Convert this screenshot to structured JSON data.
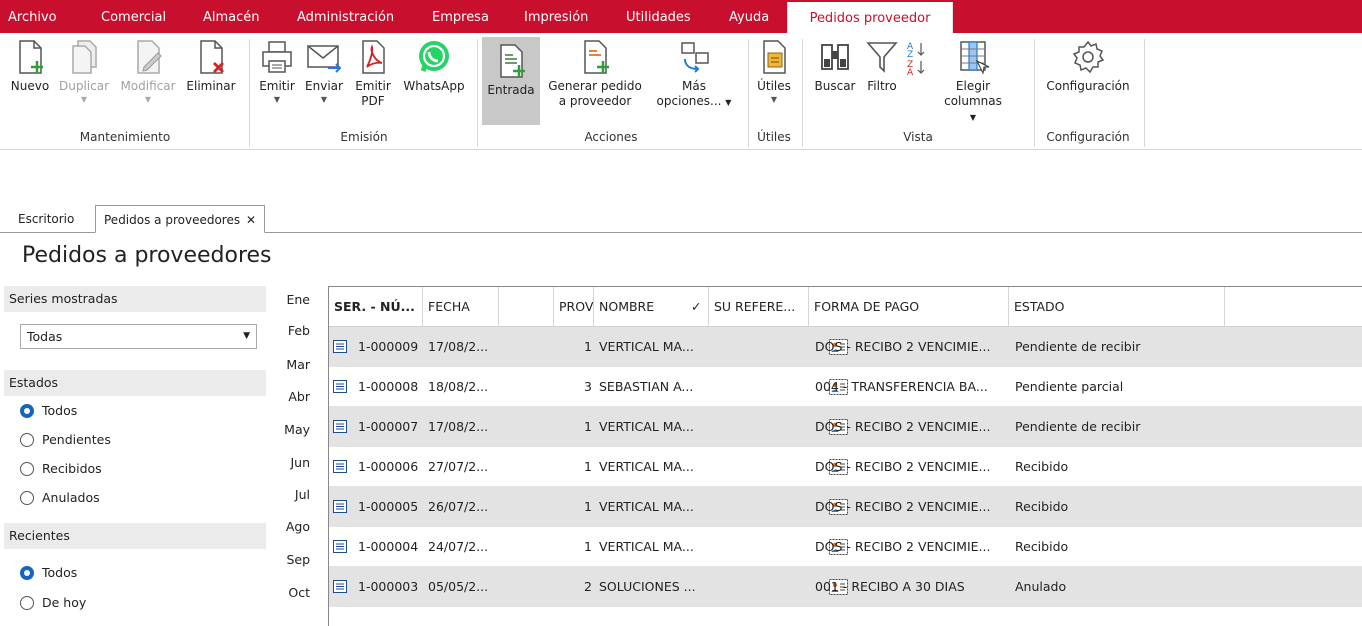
{
  "menu": {
    "items": [
      "Archivo",
      "Comercial",
      "Almacén",
      "Administración",
      "Empresa",
      "Impresión",
      "Utilidades",
      "Ayuda"
    ],
    "active": "Pedidos proveedor"
  },
  "ribbon": {
    "mantenimiento": {
      "label": "Mantenimiento",
      "nuevo": "Nuevo",
      "duplicar": "Duplicar",
      "modificar": "Modificar",
      "eliminar": "Eliminar"
    },
    "emision": {
      "label": "Emisión",
      "emitir": "Emitir",
      "enviar": "Enviar",
      "emitir_pdf_1": "Emitir",
      "emitir_pdf_2": "PDF",
      "whatsapp": "WhatsApp"
    },
    "acciones": {
      "label": "Acciones",
      "entrada": "Entrada",
      "generar_1": "Generar pedido",
      "generar_2": "a proveedor",
      "mas_1": "Más",
      "mas_2": "opciones..."
    },
    "utiles": {
      "label": "Útiles",
      "utiles": "Útiles"
    },
    "vista": {
      "label": "Vista",
      "buscar": "Buscar",
      "filtro": "Filtro",
      "elegir_1": "Elegir",
      "elegir_2": "columnas"
    },
    "configuracion": {
      "label": "Configuración",
      "configuracion": "Configuración"
    }
  },
  "tabs": [
    "Escritorio",
    "Pedidos a proveedores"
  ],
  "page_title": "Pedidos a proveedores",
  "filters": {
    "series": {
      "label": "Series mostradas",
      "value": "Todas"
    },
    "estados": {
      "label": "Estados",
      "options": [
        "Todos",
        "Pendientes",
        "Recibidos",
        "Anulados"
      ],
      "selected": "Todos"
    },
    "recientes": {
      "label": "Recientes",
      "options": [
        "Todos",
        "De hoy"
      ],
      "selected": "Todos"
    }
  },
  "months": [
    "Ene",
    "Feb",
    "Mar",
    "Abr",
    "May",
    "Jun",
    "Jul",
    "Ago",
    "Sep",
    "Oct"
  ],
  "table": {
    "columns": [
      "SER. - NÚ...",
      "FECHA",
      "",
      "PROV.",
      "NOMBRE",
      "✓",
      "SU REFERE...",
      "FORMA DE PAGO",
      "ESTADO"
    ],
    "rows": [
      {
        "num": "1-000009",
        "fecha": "17/08/2...",
        "prov": "1",
        "nombre": "VERTICAL MA...",
        "ref": "",
        "pago": "DOS - RECIBO 2 VENCIMIE...",
        "estado": "Pendiente de recibir"
      },
      {
        "num": "1-000008",
        "fecha": "18/08/2...",
        "prov": "3",
        "nombre": "SEBASTIAN A...",
        "ref": "",
        "pago": "004 - TRANSFERENCIA BA...",
        "estado": "Pendiente parcial"
      },
      {
        "num": "1-000007",
        "fecha": "17/08/2...",
        "prov": "1",
        "nombre": "VERTICAL MA...",
        "ref": "",
        "pago": "DOS - RECIBO 2 VENCIMIE...",
        "estado": "Pendiente de recibir"
      },
      {
        "num": "1-000006",
        "fecha": "27/07/2...",
        "prov": "1",
        "nombre": "VERTICAL MA...",
        "ref": "",
        "pago": "DOS - RECIBO 2 VENCIMIE...",
        "estado": "Recibido"
      },
      {
        "num": "1-000005",
        "fecha": "26/07/2...",
        "prov": "1",
        "nombre": "VERTICAL MA...",
        "ref": "",
        "pago": "DOS - RECIBO 2 VENCIMIE...",
        "estado": "Recibido"
      },
      {
        "num": "1-000004",
        "fecha": "24/07/2...",
        "prov": "1",
        "nombre": "VERTICAL MA...",
        "ref": "",
        "pago": "DOS - RECIBO 2 VENCIMIE...",
        "estado": "Recibido"
      },
      {
        "num": "1-000003",
        "fecha": "05/05/2...",
        "prov": "2",
        "nombre": "SOLUCIONES ...",
        "ref": "",
        "pago": "001 - RECIBO A 30 DIAS",
        "estado": "Anulado"
      }
    ]
  },
  "colors": {
    "brand": "#c8102e",
    "selected_row": "#e3e3e3",
    "radio_on": "#1565c0"
  }
}
